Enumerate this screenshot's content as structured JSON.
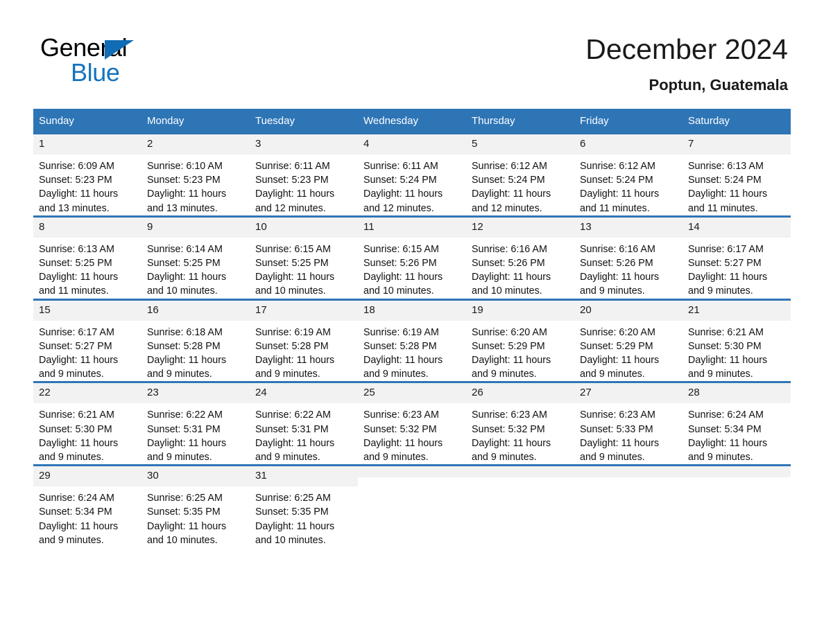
{
  "brand": {
    "name_part1": "General",
    "name_part2": "Blue",
    "triangle_icon": "triangle-logo-icon",
    "accent_color": "#1573BE"
  },
  "header": {
    "title": "December 2024",
    "location": "Poptun, Guatemala"
  },
  "theme": {
    "header_blue": "#2E75B6",
    "daynum_gray": "#F2F2F2",
    "text_black": "#111111"
  },
  "weekday_headers": [
    "Sunday",
    "Monday",
    "Tuesday",
    "Wednesday",
    "Thursday",
    "Friday",
    "Saturday"
  ],
  "weeks": [
    [
      {
        "day": "1",
        "sunrise": "Sunrise: 6:09 AM",
        "sunset": "Sunset: 5:23 PM",
        "daylight_line1": "Daylight: 11 hours",
        "daylight_line2": "and 13 minutes."
      },
      {
        "day": "2",
        "sunrise": "Sunrise: 6:10 AM",
        "sunset": "Sunset: 5:23 PM",
        "daylight_line1": "Daylight: 11 hours",
        "daylight_line2": "and 13 minutes."
      },
      {
        "day": "3",
        "sunrise": "Sunrise: 6:11 AM",
        "sunset": "Sunset: 5:23 PM",
        "daylight_line1": "Daylight: 11 hours",
        "daylight_line2": "and 12 minutes."
      },
      {
        "day": "4",
        "sunrise": "Sunrise: 6:11 AM",
        "sunset": "Sunset: 5:24 PM",
        "daylight_line1": "Daylight: 11 hours",
        "daylight_line2": "and 12 minutes."
      },
      {
        "day": "5",
        "sunrise": "Sunrise: 6:12 AM",
        "sunset": "Sunset: 5:24 PM",
        "daylight_line1": "Daylight: 11 hours",
        "daylight_line2": "and 12 minutes."
      },
      {
        "day": "6",
        "sunrise": "Sunrise: 6:12 AM",
        "sunset": "Sunset: 5:24 PM",
        "daylight_line1": "Daylight: 11 hours",
        "daylight_line2": "and 11 minutes."
      },
      {
        "day": "7",
        "sunrise": "Sunrise: 6:13 AM",
        "sunset": "Sunset: 5:24 PM",
        "daylight_line1": "Daylight: 11 hours",
        "daylight_line2": "and 11 minutes."
      }
    ],
    [
      {
        "day": "8",
        "sunrise": "Sunrise: 6:13 AM",
        "sunset": "Sunset: 5:25 PM",
        "daylight_line1": "Daylight: 11 hours",
        "daylight_line2": "and 11 minutes."
      },
      {
        "day": "9",
        "sunrise": "Sunrise: 6:14 AM",
        "sunset": "Sunset: 5:25 PM",
        "daylight_line1": "Daylight: 11 hours",
        "daylight_line2": "and 10 minutes."
      },
      {
        "day": "10",
        "sunrise": "Sunrise: 6:15 AM",
        "sunset": "Sunset: 5:25 PM",
        "daylight_line1": "Daylight: 11 hours",
        "daylight_line2": "and 10 minutes."
      },
      {
        "day": "11",
        "sunrise": "Sunrise: 6:15 AM",
        "sunset": "Sunset: 5:26 PM",
        "daylight_line1": "Daylight: 11 hours",
        "daylight_line2": "and 10 minutes."
      },
      {
        "day": "12",
        "sunrise": "Sunrise: 6:16 AM",
        "sunset": "Sunset: 5:26 PM",
        "daylight_line1": "Daylight: 11 hours",
        "daylight_line2": "and 10 minutes."
      },
      {
        "day": "13",
        "sunrise": "Sunrise: 6:16 AM",
        "sunset": "Sunset: 5:26 PM",
        "daylight_line1": "Daylight: 11 hours",
        "daylight_line2": "and 9 minutes."
      },
      {
        "day": "14",
        "sunrise": "Sunrise: 6:17 AM",
        "sunset": "Sunset: 5:27 PM",
        "daylight_line1": "Daylight: 11 hours",
        "daylight_line2": "and 9 minutes."
      }
    ],
    [
      {
        "day": "15",
        "sunrise": "Sunrise: 6:17 AM",
        "sunset": "Sunset: 5:27 PM",
        "daylight_line1": "Daylight: 11 hours",
        "daylight_line2": "and 9 minutes."
      },
      {
        "day": "16",
        "sunrise": "Sunrise: 6:18 AM",
        "sunset": "Sunset: 5:28 PM",
        "daylight_line1": "Daylight: 11 hours",
        "daylight_line2": "and 9 minutes."
      },
      {
        "day": "17",
        "sunrise": "Sunrise: 6:19 AM",
        "sunset": "Sunset: 5:28 PM",
        "daylight_line1": "Daylight: 11 hours",
        "daylight_line2": "and 9 minutes."
      },
      {
        "day": "18",
        "sunrise": "Sunrise: 6:19 AM",
        "sunset": "Sunset: 5:28 PM",
        "daylight_line1": "Daylight: 11 hours",
        "daylight_line2": "and 9 minutes."
      },
      {
        "day": "19",
        "sunrise": "Sunrise: 6:20 AM",
        "sunset": "Sunset: 5:29 PM",
        "daylight_line1": "Daylight: 11 hours",
        "daylight_line2": "and 9 minutes."
      },
      {
        "day": "20",
        "sunrise": "Sunrise: 6:20 AM",
        "sunset": "Sunset: 5:29 PM",
        "daylight_line1": "Daylight: 11 hours",
        "daylight_line2": "and 9 minutes."
      },
      {
        "day": "21",
        "sunrise": "Sunrise: 6:21 AM",
        "sunset": "Sunset: 5:30 PM",
        "daylight_line1": "Daylight: 11 hours",
        "daylight_line2": "and 9 minutes."
      }
    ],
    [
      {
        "day": "22",
        "sunrise": "Sunrise: 6:21 AM",
        "sunset": "Sunset: 5:30 PM",
        "daylight_line1": "Daylight: 11 hours",
        "daylight_line2": "and 9 minutes."
      },
      {
        "day": "23",
        "sunrise": "Sunrise: 6:22 AM",
        "sunset": "Sunset: 5:31 PM",
        "daylight_line1": "Daylight: 11 hours",
        "daylight_line2": "and 9 minutes."
      },
      {
        "day": "24",
        "sunrise": "Sunrise: 6:22 AM",
        "sunset": "Sunset: 5:31 PM",
        "daylight_line1": "Daylight: 11 hours",
        "daylight_line2": "and 9 minutes."
      },
      {
        "day": "25",
        "sunrise": "Sunrise: 6:23 AM",
        "sunset": "Sunset: 5:32 PM",
        "daylight_line1": "Daylight: 11 hours",
        "daylight_line2": "and 9 minutes."
      },
      {
        "day": "26",
        "sunrise": "Sunrise: 6:23 AM",
        "sunset": "Sunset: 5:32 PM",
        "daylight_line1": "Daylight: 11 hours",
        "daylight_line2": "and 9 minutes."
      },
      {
        "day": "27",
        "sunrise": "Sunrise: 6:23 AM",
        "sunset": "Sunset: 5:33 PM",
        "daylight_line1": "Daylight: 11 hours",
        "daylight_line2": "and 9 minutes."
      },
      {
        "day": "28",
        "sunrise": "Sunrise: 6:24 AM",
        "sunset": "Sunset: 5:34 PM",
        "daylight_line1": "Daylight: 11 hours",
        "daylight_line2": "and 9 minutes."
      }
    ],
    [
      {
        "day": "29",
        "sunrise": "Sunrise: 6:24 AM",
        "sunset": "Sunset: 5:34 PM",
        "daylight_line1": "Daylight: 11 hours",
        "daylight_line2": "and 9 minutes."
      },
      {
        "day": "30",
        "sunrise": "Sunrise: 6:25 AM",
        "sunset": "Sunset: 5:35 PM",
        "daylight_line1": "Daylight: 11 hours",
        "daylight_line2": "and 10 minutes."
      },
      {
        "day": "31",
        "sunrise": "Sunrise: 6:25 AM",
        "sunset": "Sunset: 5:35 PM",
        "daylight_line1": "Daylight: 11 hours",
        "daylight_line2": "and 10 minutes."
      },
      {
        "day": "",
        "sunrise": "",
        "sunset": "",
        "daylight_line1": "",
        "daylight_line2": ""
      },
      {
        "day": "",
        "sunrise": "",
        "sunset": "",
        "daylight_line1": "",
        "daylight_line2": ""
      },
      {
        "day": "",
        "sunrise": "",
        "sunset": "",
        "daylight_line1": "",
        "daylight_line2": ""
      },
      {
        "day": "",
        "sunrise": "",
        "sunset": "",
        "daylight_line1": "",
        "daylight_line2": ""
      }
    ]
  ]
}
